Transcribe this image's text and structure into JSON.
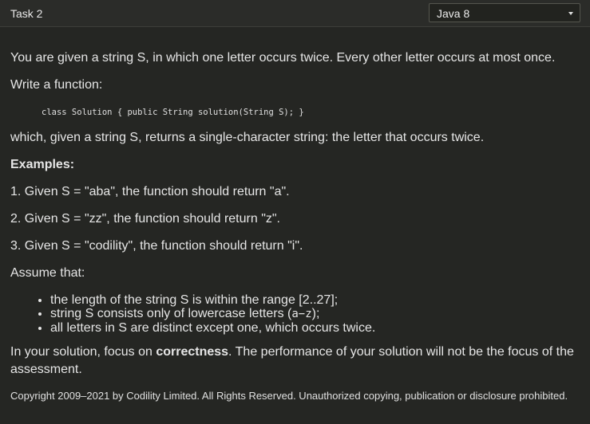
{
  "header": {
    "task_title": "Task 2",
    "language": "Java 8"
  },
  "description": {
    "intro": "You are given a string S, in which one letter occurs twice. Every other letter occurs at most once.",
    "write_function": "Write a function:",
    "code_signature": "class Solution { public String solution(String S); }",
    "returns": "which, given a string S, returns a single-character string: the letter that occurs twice.",
    "examples_heading": "Examples:",
    "examples": [
      "1. Given S = \"aba\", the function should return \"a\".",
      "2. Given S = \"zz\", the function should return \"z\".",
      "3. Given S = \"codility\", the function should return \"i\"."
    ],
    "assume_heading": "Assume that:",
    "assumptions": {
      "a1": "the length of the string S is within the range [2..27];",
      "a2_prefix": "string S consists only of lowercase letters (",
      "a2_code": "a−z",
      "a2_suffix": ");",
      "a3": "all letters in S are distinct except one, which occurs twice."
    },
    "focus_prefix": "In your solution, focus on ",
    "focus_bold": "correctness",
    "focus_suffix": ". The performance of your solution will not be the focus of the assessment."
  },
  "footer": {
    "copyright": "Copyright 2009–2021 by Codility Limited. All Rights Reserved. Unauthorized copying, publication or disclosure prohibited."
  }
}
